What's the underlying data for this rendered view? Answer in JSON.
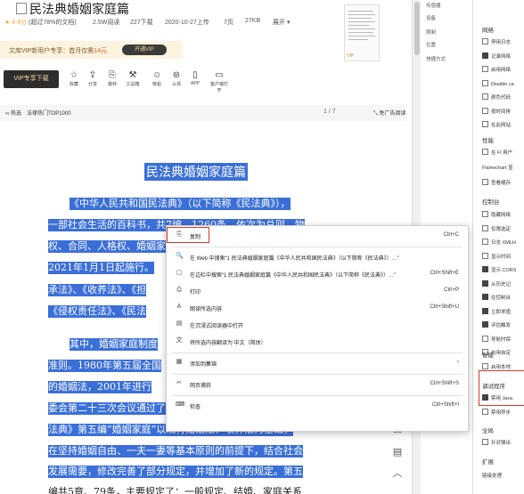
{
  "doc": {
    "title": "民法典婚姻家庭篇",
    "meta": {
      "rating": "4.4分",
      "liked": "(超过78%的文档)",
      "reads": "2.5W阅读",
      "downloads": "227下载",
      "upload_date": "2020-10-27上传",
      "pages": "7页",
      "size": "27KB",
      "expand": "展开"
    },
    "vip_promo": {
      "text": "文库VIP新用户专享：首月仅需",
      "price": "14元",
      "button": "开通VIP"
    },
    "vip_download": "VIP专享下载",
    "tools": [
      {
        "icon": "☆",
        "label": "收藏"
      },
      {
        "icon": "⇪",
        "label": "分享"
      },
      {
        "icon": "⎘",
        "label": "稿存"
      },
      {
        "icon": "⚒",
        "label": "工具箱"
      },
      {
        "icon": "☺",
        "label": "吸铅"
      },
      {
        "icon": "⊜",
        "label": "认领"
      },
      {
        "icon": "▯",
        "label": "APP"
      },
      {
        "icon": "▭",
        "label": "客户端打开"
      }
    ],
    "thumb_badge": "VIP",
    "subbar": {
      "badge": "热选",
      "ranking": "法律热门TOP1000",
      "page": "1 / 7",
      "read_mode": "免广告阅读"
    },
    "heading": "民法典婚姻家庭篇",
    "lines": [
      "《中华人民共和国民法典》（以下简称《民法典》），",
      "一部社会生活的百科书，共7编、1260条，依次为总则、物",
      "权、合同、人格权、婚姻家庭、继承、侵权责任和附则，自",
      "2021年1月1日起施行。",
      "承法》、《收养法》、《担",
      "《侵权责任法》、《民法",
      "其中，婚姻家庭制度",
      "准则。1980年第五届全国",
      "的婚姻法，2001年进行",
      "委会第二十三次会议通过了收养法，1998年作了修改。《民",
      "法典》第五编“婚姻家庭”以现行婚姻法、收养法为基础，",
      "在坚持婚姻自由、一夫一妻等基本原则的前提下，结合社会",
      "发展需要，修改完善了部分规定，并增加了新的规定。第五"
    ],
    "last_line_plain": "编共5章、79条，主要规定了：一般规定、结婚、家庭关系",
    "tail_char": "第五"
  },
  "devtools": {
    "left_items": [
      "传感器",
      "设备",
      "限制",
      "位置",
      "快捷方式"
    ],
    "right": {
      "network_header": "网络",
      "network_items": [
        {
          "label": "停用日志",
          "checked": false
        },
        {
          "label": "记录网络",
          "checked": true
        },
        {
          "label": "启用网络",
          "checked": false
        },
        {
          "label": "Disable ca",
          "checked": false
        },
        {
          "label": "颜色代码",
          "checked": false
        },
        {
          "label": "按时间排",
          "checked": false
        },
        {
          "label": "在此网站",
          "checked": false
        }
      ],
      "perf_header": "性能",
      "perf_items": [
        {
          "label": "在 Fl 用户",
          "checked": false
        }
      ],
      "flame_label": "Flamechart 显",
      "flame_item": {
        "label": "查看缓存",
        "checked": false
      },
      "console_header": "控制台",
      "console_items": [
        {
          "label": "隐藏网络",
          "checked": false
        },
        {
          "label": "仅限选定",
          "checked": false
        },
        {
          "label": "日志 XMLH",
          "checked": false
        },
        {
          "label": "显示时间",
          "checked": false
        },
        {
          "label": "显示 CORS",
          "checked": true
        },
        {
          "label": "从历史记",
          "checked": true
        },
        {
          "label": "在控制台",
          "checked": true
        },
        {
          "label": "立即求值",
          "checked": true
        },
        {
          "label": "评估触发",
          "checked": true
        },
        {
          "label": "导航时保",
          "checked": false
        },
        {
          "label": "启用自定",
          "checked": false
        }
      ],
      "smart_header": "智能",
      "smart_item": {
        "label": "启用本地",
        "checked": false
      },
      "debug_header": "调试程序",
      "debug_item": {
        "label": "禁用 Java",
        "checked": true
      },
      "debug_item2": {
        "label": "禁用异步",
        "checked": false
      },
      "global_header": "全局",
      "global_item": {
        "label": "针对弹出",
        "checked": false
      },
      "ext_header": "扩展",
      "ext_item": "链接处理"
    }
  },
  "context_menu": [
    {
      "icon": "⎘",
      "label": "复制",
      "key": "Ctrl+C"
    },
    {
      "sep": true
    },
    {
      "icon": "🔍",
      "label": "在 Web 中搜索“1 民法典婚姻家庭篇《中华人民共和国民法典》（以下简称《民法典》）…”",
      "key": ""
    },
    {
      "icon": "▢",
      "label": "在边栏中搜索“1 民法典婚姻家庭篇《中华人民共和国民法典》（以下简称《民法典》）…”",
      "key": "Ctrl+Shift+E"
    },
    {
      "icon": "⎙",
      "label": "打印",
      "key": "Ctrl+P"
    },
    {
      "icon": "A",
      "label": "朗读所选内容",
      "key": "Ctrl+Shift+U"
    },
    {
      "icon": "▤",
      "label": "在沉浸式阅读器中打开",
      "key": ""
    },
    {
      "icon": "文",
      "label": "将所选内容翻译为 中文（简体）",
      "key": ""
    },
    {
      "sep": true
    },
    {
      "icon": "▦",
      "label": "添加到集锦",
      "key": "›"
    },
    {
      "sep": true
    },
    {
      "icon": "✂",
      "label": "网页捕获",
      "key": "Ctrl+Shift+S"
    },
    {
      "sep": true
    },
    {
      "icon": "⌨",
      "label": "检查",
      "key": "Ctrl+Shift+I"
    }
  ]
}
